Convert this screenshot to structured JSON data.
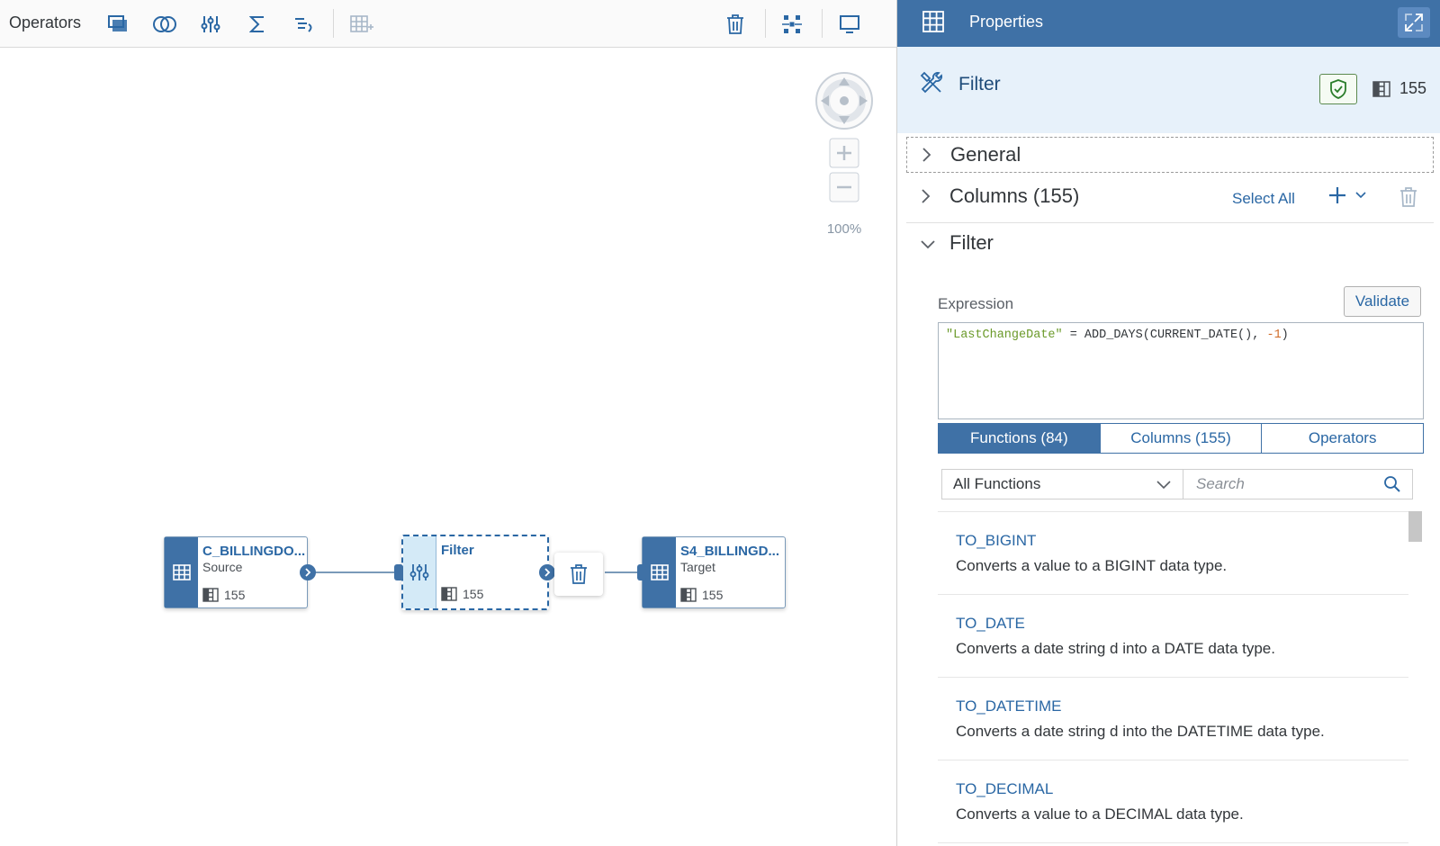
{
  "toolbar": {
    "title": "Operators",
    "icons": [
      "projection-icon",
      "join-icon",
      "filter-icon",
      "aggregation-icon",
      "calculated-column-icon",
      "add-table-icon",
      "delete-icon",
      "auto-layout-icon",
      "preview-icon"
    ]
  },
  "canvas": {
    "zoom_label": "100%",
    "nodes": [
      {
        "name": "C_BILLINGDO...",
        "subtitle": "Source",
        "count": "155"
      },
      {
        "name": "Filter",
        "subtitle": "",
        "count": "155"
      },
      {
        "name": "S4_BILLINGD...",
        "subtitle": "Target",
        "count": "155"
      }
    ]
  },
  "panel": {
    "title": "Properties",
    "operator_name": "Filter",
    "column_count": "155",
    "sections": {
      "general": "General",
      "columns": "Columns (155)",
      "filter": "Filter"
    },
    "select_all_label": "Select All",
    "expression": {
      "label": "Expression",
      "validate_label": "Validate",
      "tokens": [
        "\"LastChangeDate\"",
        " = ADD_DAYS(CURRENT_DATE(), ",
        "-1",
        ")"
      ]
    },
    "tabs": [
      {
        "label": "Functions (84)",
        "active": true
      },
      {
        "label": "Columns (155)",
        "active": false
      },
      {
        "label": "Operators",
        "active": false
      }
    ],
    "function_filter": "All Functions",
    "search_placeholder": "Search",
    "functions": [
      {
        "name": "TO_BIGINT",
        "description": "Converts a value to a BIGINT data type."
      },
      {
        "name": "TO_DATE",
        "description": "Converts a date string d into a DATE data type."
      },
      {
        "name": "TO_DATETIME",
        "description": "Converts a date string d into the DATETIME data type."
      },
      {
        "name": "TO_DECIMAL",
        "description": "Converts a value to a DECIMAL data type."
      }
    ]
  },
  "colors": {
    "accent": "#3f71a6",
    "link": "#2a67a4",
    "selected_fill": "#d4eaf7",
    "subheader": "#e7f1fa"
  }
}
